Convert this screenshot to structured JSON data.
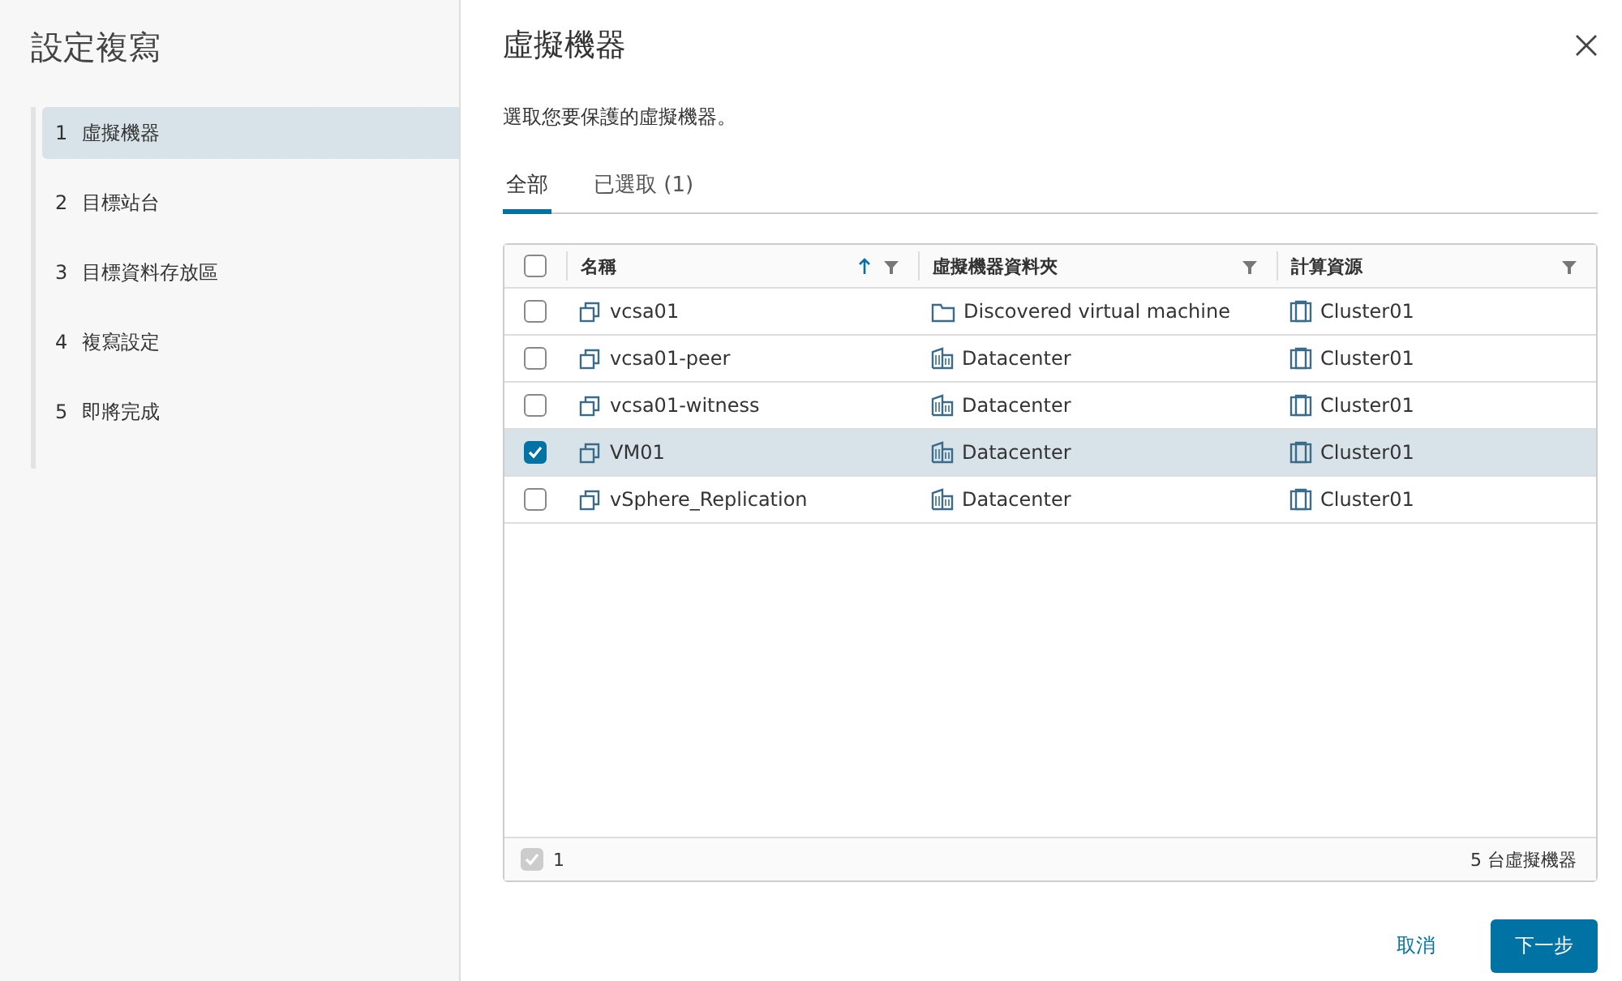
{
  "sidebar": {
    "title": "設定複寫",
    "steps": [
      {
        "number": "1",
        "label": "虛擬機器",
        "selected": true
      },
      {
        "number": "2",
        "label": "目標站台",
        "selected": false
      },
      {
        "number": "3",
        "label": "目標資料存放區",
        "selected": false
      },
      {
        "number": "4",
        "label": "複寫設定",
        "selected": false
      },
      {
        "number": "5",
        "label": "即將完成",
        "selected": false
      }
    ]
  },
  "dialog": {
    "title": "虛擬機器",
    "instruction": "選取您要保護的虛擬機器。"
  },
  "tabs": [
    {
      "label": "全部",
      "selected": true
    },
    {
      "label": "已選取 (1)",
      "selected": false
    }
  ],
  "table": {
    "header_checked": false,
    "columns": [
      {
        "label": "名稱",
        "sorted": true
      },
      {
        "label": "虛擬機器資料夾",
        "sorted": false
      },
      {
        "label": "計算資源",
        "sorted": false
      }
    ],
    "rows": [
      {
        "name": "vcsa01",
        "folder": "Discovered virtual machine",
        "kind": "folder",
        "compute": "Cluster01",
        "selected": false
      },
      {
        "name": "vcsa01-peer",
        "folder": "Datacenter",
        "kind": "datacenter",
        "compute": "Cluster01",
        "selected": false
      },
      {
        "name": "vcsa01-witness",
        "folder": "Datacenter",
        "kind": "datacenter",
        "compute": "Cluster01",
        "selected": false
      },
      {
        "name": "VM01",
        "folder": "Datacenter",
        "kind": "datacenter",
        "compute": "Cluster01",
        "selected": true
      },
      {
        "name": "vSphere_Replication",
        "folder": "Datacenter",
        "kind": "datacenter",
        "compute": "Cluster01",
        "selected": false
      }
    ],
    "footer": {
      "checked": true,
      "disabled": true,
      "selected_count": "1",
      "total": "5 台虛擬機器"
    }
  },
  "buttons": {
    "cancel": "取消",
    "next": "下一步"
  }
}
